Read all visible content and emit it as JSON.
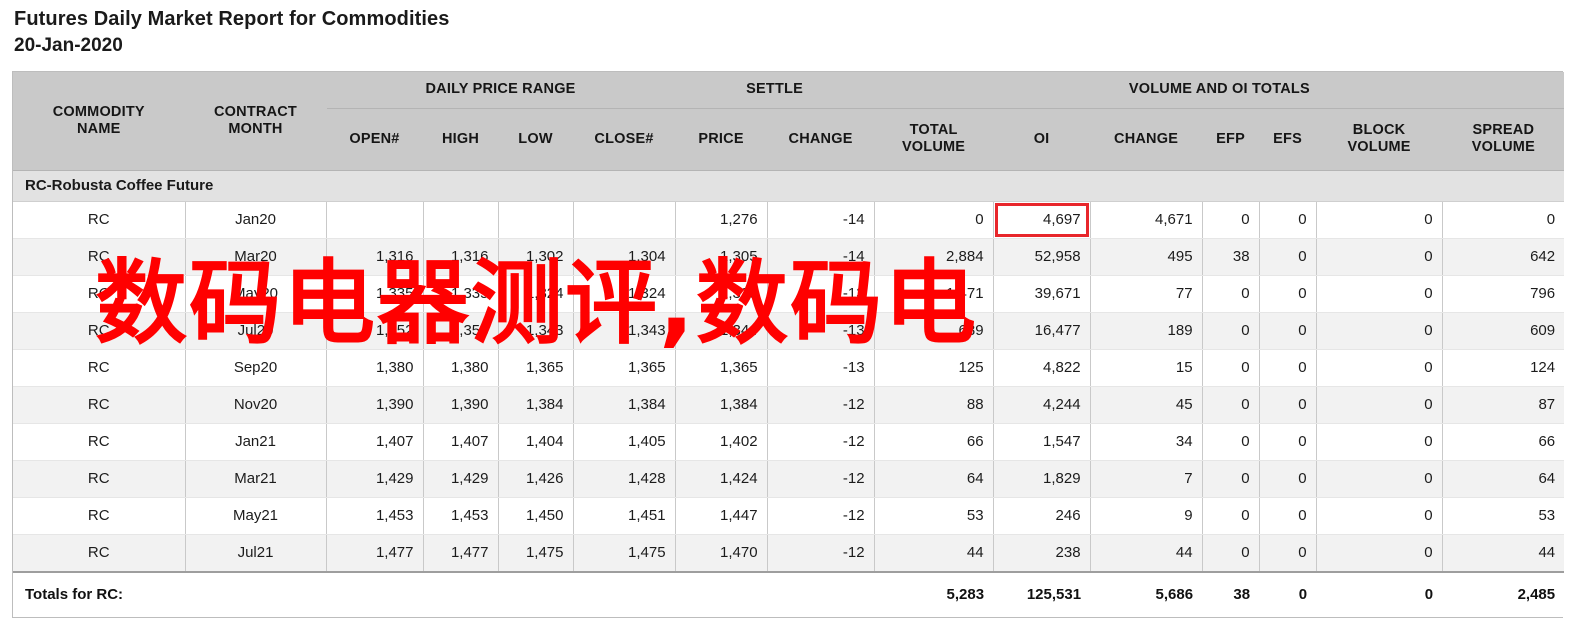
{
  "report": {
    "title": "Futures Daily Market Report for Commodities",
    "date": "20-Jan-2020"
  },
  "watermark": {
    "text": "数码电器测评,数码电",
    "color": "#ff0000"
  },
  "highlight": {
    "color": "#e8262b",
    "cell": "oi-jan20"
  },
  "table": {
    "group_headers": {
      "commodity_name": "COMMODITY NAME",
      "commodity_name_l1": "COMMODITY",
      "commodity_name_l2": "NAME",
      "contract_month_l1": "CONTRACT",
      "contract_month_l2": "MONTH",
      "daily_price_range": "DAILY PRICE RANGE",
      "settle": "SETTLE",
      "volume_and_oi_totals": "VOLUME AND OI TOTALS"
    },
    "sub_headers": {
      "open": "OPEN#",
      "high": "HIGH",
      "low": "LOW",
      "close": "CLOSE#",
      "price": "PRICE",
      "change": "CHANGE",
      "total_volume_l1": "TOTAL",
      "total_volume_l2": "VOLUME",
      "oi": "OI",
      "oi_change": "CHANGE",
      "efp": "EFP",
      "efs": "EFS",
      "block_volume_l1": "BLOCK",
      "block_volume_l2": "VOLUME",
      "spread_volume_l1": "SPREAD",
      "spread_volume_l2": "VOLUME"
    },
    "section_title": "RC-Robusta Coffee Future",
    "rows": [
      {
        "commodity": "RC",
        "month": "Jan20",
        "open": "",
        "high": "",
        "low": "",
        "close": "",
        "price": "1,276",
        "change": "-14",
        "total_volume": "0",
        "oi": "4,697",
        "oi_change": "4,671",
        "efp": "0",
        "efs": "0",
        "block_volume": "0",
        "spread_volume": "0"
      },
      {
        "commodity": "RC",
        "month": "Mar20",
        "open": "1,316",
        "high": "1,316",
        "low": "1,302",
        "close": "1,304",
        "price": "1,305",
        "change": "-14",
        "total_volume": "2,884",
        "oi": "52,958",
        "oi_change": "495",
        "efp": "38",
        "efs": "0",
        "block_volume": "0",
        "spread_volume": "642"
      },
      {
        "commodity": "RC",
        "month": "May20",
        "open": "1,335",
        "high": "1,335",
        "low": "1,324",
        "close": "1,324",
        "price": "1,325",
        "change": "-13",
        "total_volume": "1,471",
        "oi": "39,671",
        "oi_change": "77",
        "efp": "0",
        "efs": "0",
        "block_volume": "0",
        "spread_volume": "796"
      },
      {
        "commodity": "RC",
        "month": "Jul20",
        "open": "1,352",
        "high": "1,353",
        "low": "1,343",
        "close": "1,343",
        "price": "1,344",
        "change": "-13",
        "total_volume": "689",
        "oi": "16,477",
        "oi_change": "189",
        "efp": "0",
        "efs": "0",
        "block_volume": "0",
        "spread_volume": "609"
      },
      {
        "commodity": "RC",
        "month": "Sep20",
        "open": "1,380",
        "high": "1,380",
        "low": "1,365",
        "close": "1,365",
        "price": "1,365",
        "change": "-13",
        "total_volume": "125",
        "oi": "4,822",
        "oi_change": "15",
        "efp": "0",
        "efs": "0",
        "block_volume": "0",
        "spread_volume": "124"
      },
      {
        "commodity": "RC",
        "month": "Nov20",
        "open": "1,390",
        "high": "1,390",
        "low": "1,384",
        "close": "1,384",
        "price": "1,384",
        "change": "-12",
        "total_volume": "88",
        "oi": "4,244",
        "oi_change": "45",
        "efp": "0",
        "efs": "0",
        "block_volume": "0",
        "spread_volume": "87"
      },
      {
        "commodity": "RC",
        "month": "Jan21",
        "open": "1,407",
        "high": "1,407",
        "low": "1,404",
        "close": "1,405",
        "price": "1,402",
        "change": "-12",
        "total_volume": "66",
        "oi": "1,547",
        "oi_change": "34",
        "efp": "0",
        "efs": "0",
        "block_volume": "0",
        "spread_volume": "66"
      },
      {
        "commodity": "RC",
        "month": "Mar21",
        "open": "1,429",
        "high": "1,429",
        "low": "1,426",
        "close": "1,428",
        "price": "1,424",
        "change": "-12",
        "total_volume": "64",
        "oi": "1,829",
        "oi_change": "7",
        "efp": "0",
        "efs": "0",
        "block_volume": "0",
        "spread_volume": "64"
      },
      {
        "commodity": "RC",
        "month": "May21",
        "open": "1,453",
        "high": "1,453",
        "low": "1,450",
        "close": "1,451",
        "price": "1,447",
        "change": "-12",
        "total_volume": "53",
        "oi": "246",
        "oi_change": "9",
        "efp": "0",
        "efs": "0",
        "block_volume": "0",
        "spread_volume": "53"
      },
      {
        "commodity": "RC",
        "month": "Jul21",
        "open": "1,477",
        "high": "1,477",
        "low": "1,475",
        "close": "1,475",
        "price": "1,470",
        "change": "-12",
        "total_volume": "44",
        "oi": "238",
        "oi_change": "44",
        "efp": "0",
        "efs": "0",
        "block_volume": "0",
        "spread_volume": "44"
      }
    ],
    "totals": {
      "label": "Totals for RC:",
      "total_volume": "5,283",
      "oi": "125,531",
      "oi_change": "5,686",
      "efp": "38",
      "efs": "0",
      "block_volume": "0",
      "spread_volume": "2,485"
    }
  }
}
